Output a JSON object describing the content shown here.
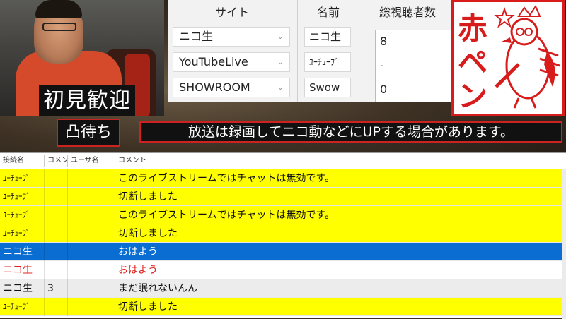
{
  "overlay": {
    "welcome": "初見歓迎",
    "waiting": "凸待ち",
    "notice": "放送は録画してニコ動などにUPする場合があります。"
  },
  "site_panel": {
    "headers": {
      "site": "サイト",
      "name": "名前",
      "total_viewers": "総視聴者数"
    },
    "rows": [
      {
        "site": "ニコ生",
        "name": "ニコ生",
        "count": "8"
      },
      {
        "site": "YouTubeLive",
        "name": "ﾕｰﾁｭｰﾌﾞ",
        "count": "-"
      },
      {
        "site": "SHOWROOM",
        "name": "Swow",
        "count": "0"
      }
    ]
  },
  "stamp": {
    "text": "赤ペン",
    "color": "#d81c1c"
  },
  "comment_list": {
    "columns": {
      "connection": "接続名",
      "count": "コメン",
      "user": "ユーザ名",
      "comment": "コメント"
    },
    "rows": [
      {
        "connection": "ﾕｰﾁｭｰﾌﾞ",
        "count": "",
        "user": "",
        "comment": "このライブストリームではチャットは無効です。",
        "style": "yellow"
      },
      {
        "connection": "ﾕｰﾁｭｰﾌﾞ",
        "count": "",
        "user": "",
        "comment": "切断しました",
        "style": "yellow"
      },
      {
        "connection": "ﾕｰﾁｭｰﾌﾞ",
        "count": "",
        "user": "",
        "comment": "このライブストリームではチャットは無効です。",
        "style": "yellow"
      },
      {
        "connection": "ﾕｰﾁｭｰﾌﾞ",
        "count": "",
        "user": "",
        "comment": "切断しました",
        "style": "yellow"
      },
      {
        "connection": "ニコ生",
        "count": "",
        "user": "",
        "comment": "おはよう",
        "style": "selected"
      },
      {
        "connection": "ニコ生",
        "count": "",
        "user": "",
        "comment": "おはよう",
        "style": "red"
      },
      {
        "connection": "ニコ生",
        "count": "3",
        "user": "",
        "comment": "まだ眠れないんん",
        "style": "gray"
      },
      {
        "connection": "ﾕｰﾁｭｰﾌﾞ",
        "count": "",
        "user": "",
        "comment": "切断しました",
        "style": "yellow"
      }
    ]
  },
  "colors": {
    "highlight_yellow": "#ffff00",
    "selected_blue": "#0a6dd1",
    "caption_border": "#cc2222",
    "red_text": "#e0241e"
  }
}
